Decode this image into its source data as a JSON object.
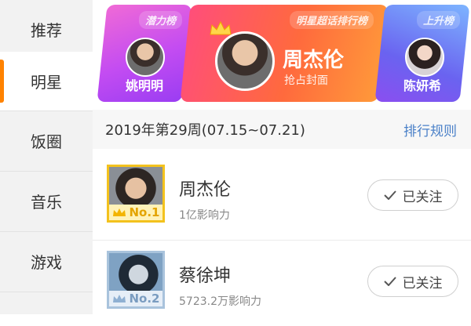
{
  "sidebar": {
    "items": [
      {
        "label": "推荐"
      },
      {
        "label": "明星"
      },
      {
        "label": "饭圈"
      },
      {
        "label": "音乐"
      },
      {
        "label": "游戏"
      }
    ]
  },
  "banner": {
    "left": {
      "tag": "潜力榜",
      "name": "姚明明"
    },
    "center": {
      "tag": "明星超话排行榜",
      "name": "周杰伦",
      "subtitle": "抢占封面"
    },
    "right": {
      "tag": "上升榜",
      "name": "陈妍希"
    }
  },
  "week": {
    "label": "2019年第29周(07.15~07.21)",
    "rule_link": "排行规则"
  },
  "list": [
    {
      "rank": "No.1",
      "name": "周杰伦",
      "influence": "1亿影响力",
      "follow_label": "已关注"
    },
    {
      "rank": "No.2",
      "name": "蔡徐坤",
      "influence": "5723.2万影响力",
      "follow_label": "已关注"
    }
  ],
  "colors": {
    "accent": "#ff8200",
    "link": "#4a80c8",
    "gold": "#f3c21d",
    "silver": "#a9c3dc"
  }
}
